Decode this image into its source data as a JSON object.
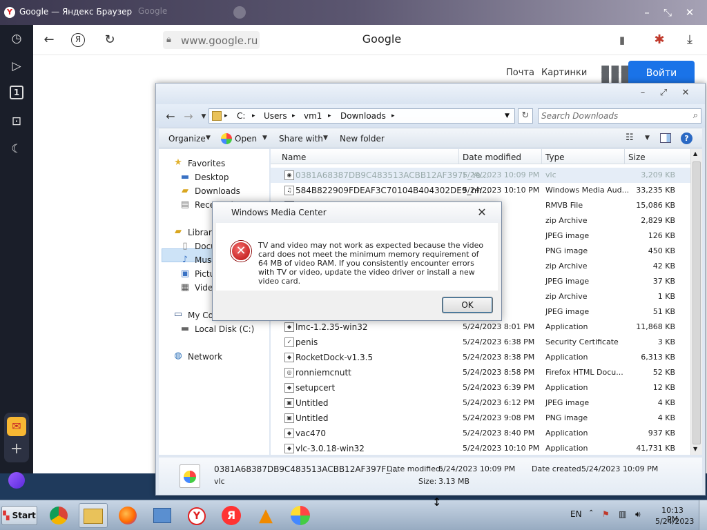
{
  "browser": {
    "title": "Google — Яндекс Браузер",
    "ghost_tab": "Google",
    "url": "www.google.ru",
    "page_title": "Google",
    "icons": [
      "yandex-logo-icon",
      "history-icon",
      "play-icon",
      "one-icon",
      "screenshot-icon",
      "moon-icon",
      "mail-icon",
      "plus-icon",
      "alice-icon",
      "back-icon",
      "ya-icon",
      "reload-icon",
      "lock-icon",
      "bookmark-icon",
      "bug-icon",
      "download-icon"
    ]
  },
  "google": {
    "mail_link": "Почта",
    "images_link": "Картинки",
    "login_button": "Войти"
  },
  "explorer": {
    "breadcrumb": [
      "C:",
      "Users",
      "vm1",
      "Downloads"
    ],
    "search_placeholder": "Search Downloads",
    "toolbar": {
      "organize": "Organize",
      "open": "Open",
      "share": "Share with",
      "new_folder": "New folder"
    },
    "nav": {
      "favorites": "Favorites",
      "desktop": "Desktop",
      "downloads": "Downloads",
      "recent": "Recent Places",
      "libraries": "Libraries",
      "documents": "Documents",
      "music": "Music",
      "pictures": "Pictures",
      "videos": "Videos",
      "computer": "My Computer",
      "local_disk": "Local Disk (C:)",
      "network": "Network"
    },
    "columns": {
      "name": "Name",
      "date": "Date modified",
      "type": "Type",
      "size": "Size"
    },
    "files": [
      {
        "name": "0381A68387DB9C483513ACBB12AF397F_Yo...",
        "date": "5/24/2023 10:09 PM",
        "type": "vlc",
        "size": "3,209 KB"
      },
      {
        "name": "584B822909FDEAF3C70104B404302DE9_nh...",
        "date": "5/24/2023 10:10 PM",
        "type": "Windows Media Aud...",
        "size": "33,235 KB"
      },
      {
        "name": "",
        "date": "10:10 PM",
        "type": "RMVB File",
        "size": "15,086 KB"
      },
      {
        "name": "",
        "date": "33 PM",
        "type": "zip Archive",
        "size": "2,829 KB"
      },
      {
        "name": "",
        "date": "7:12 PM",
        "type": "JPEG image",
        "size": "126 KB"
      },
      {
        "name": "",
        "date": "6:09 PM",
        "type": "PNG image",
        "size": "450 KB"
      },
      {
        "name": "",
        "date": "9:29 PM",
        "type": "zip Archive",
        "size": "42 KB"
      },
      {
        "name": "",
        "date": "9:11 PM",
        "type": "JPEG image",
        "size": "37 KB"
      },
      {
        "name": "",
        "date": "5:21 PM",
        "type": "zip Archive",
        "size": "1 KB"
      },
      {
        "name": "",
        "date": "9:17 PM",
        "type": "JPEG image",
        "size": "51 KB"
      },
      {
        "name": "lmc-1.2.35-win32",
        "date": "5/24/2023 8:01 PM",
        "type": "Application",
        "size": "11,868 KB"
      },
      {
        "name": "penis",
        "date": "5/24/2023 6:38 PM",
        "type": "Security Certificate",
        "size": "3 KB"
      },
      {
        "name": "RocketDock-v1.3.5",
        "date": "5/24/2023 8:38 PM",
        "type": "Application",
        "size": "6,313 KB"
      },
      {
        "name": "ronniemcnutt",
        "date": "5/24/2023 8:58 PM",
        "type": "Firefox HTML Docu...",
        "size": "52 KB"
      },
      {
        "name": "setupcert",
        "date": "5/24/2023 6:39 PM",
        "type": "Application",
        "size": "12 KB"
      },
      {
        "name": "Untitled",
        "date": "5/24/2023 6:12 PM",
        "type": "JPEG image",
        "size": "4 KB"
      },
      {
        "name": "Untitled",
        "date": "5/24/2023 9:08 PM",
        "type": "PNG image",
        "size": "4 KB"
      },
      {
        "name": "vac470",
        "date": "5/24/2023 8:40 PM",
        "type": "Application",
        "size": "937 KB"
      },
      {
        "name": "vlc-3.0.18-win32",
        "date": "5/24/2023 10:10 PM",
        "type": "Application",
        "size": "41,731 KB"
      }
    ],
    "details": {
      "filename": "0381A68387DB9C483513ACBB12AF397F_...",
      "type": "vlc",
      "modified_label": "Date modified:",
      "modified": "5/24/2023 10:09 PM",
      "created_label": "Date created:",
      "created": "5/24/2023 10:09 PM",
      "size_label": "Size:",
      "size": "3.13 MB"
    }
  },
  "dialog": {
    "title": "Windows Media Center",
    "message": "TV and video may not work as expected because the video card does not meet the minimum memory requirement of 64 MB of video RAM. If you consistently encounter errors with TV or video, update the video driver or install a new video card.",
    "ok": "OK"
  },
  "taskbar": {
    "start": "Start",
    "lang": "EN",
    "time": "10:13 PM",
    "date": "5/24/2023"
  }
}
